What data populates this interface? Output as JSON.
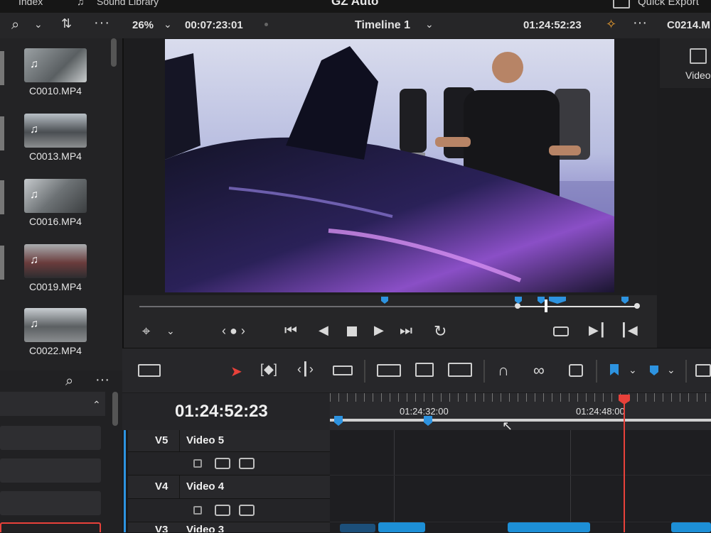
{
  "app": {
    "top_left_tab": "Index",
    "sound_library": "Sound Library",
    "project_title": "GZ Auto",
    "quick_export": "Quick Export"
  },
  "toolbar": {
    "zoom": "26%",
    "source_timecode": "00:07:23:01",
    "timeline_name": "Timeline 1",
    "record_timecode": "01:24:52:23",
    "right_clip": "C0214.M",
    "right_panel_label": "Video"
  },
  "media_pool": {
    "clips": [
      {
        "name": "C0010.MP4"
      },
      {
        "name": "C0013.MP4"
      },
      {
        "name": "C0016.MP4"
      },
      {
        "name": "C0019.MP4"
      },
      {
        "name": "C0022.MP4"
      }
    ]
  },
  "timeline": {
    "current_timecode": "01:24:52:23",
    "ruler_labels": [
      "01:24:32:00",
      "01:24:48:00"
    ],
    "tracks": [
      {
        "id": "V5",
        "name": "Video 5"
      },
      {
        "id": "V4",
        "name": "Video 4"
      },
      {
        "id": "V3",
        "name": "Video 3"
      }
    ]
  },
  "colors": {
    "accent_blue": "#1d8fd6",
    "playhead_red": "#e8413a",
    "panel_dark": "#1c1c1e"
  }
}
